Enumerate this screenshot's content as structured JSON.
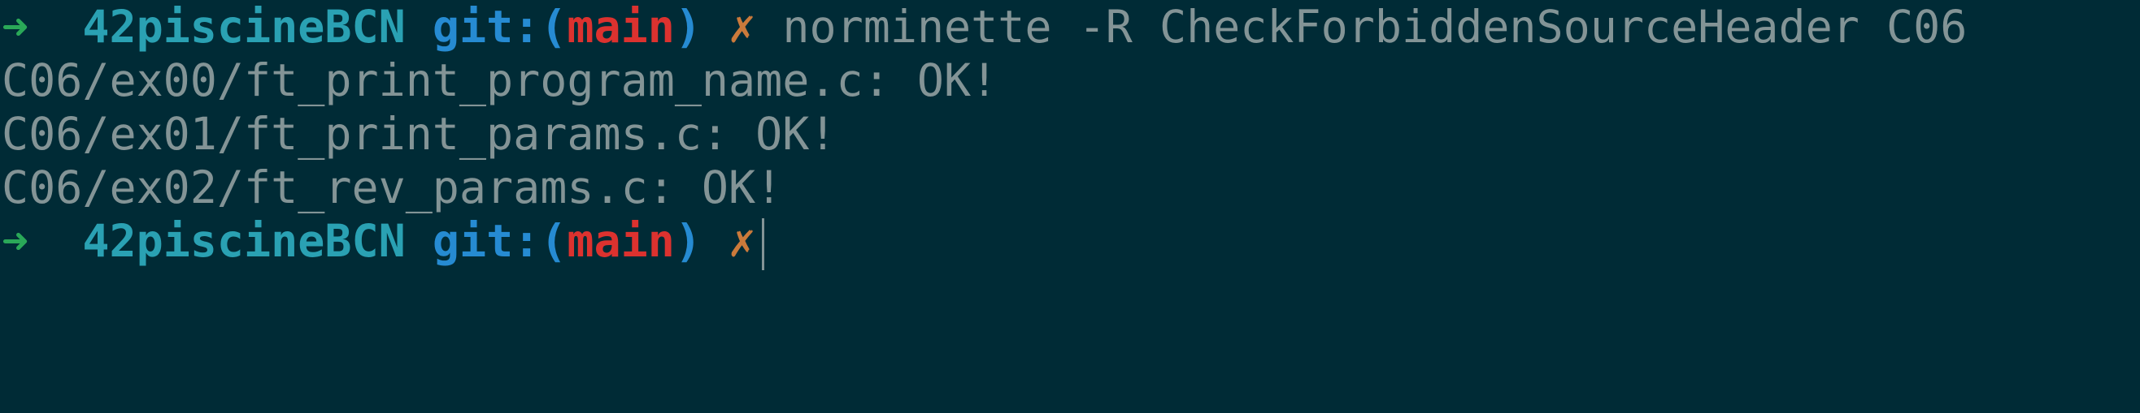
{
  "prompt": {
    "arrow": "➜",
    "directory": "42piscineBCN",
    "git_label": "git:",
    "open_paren": "(",
    "branch": "main",
    "close_paren": ")",
    "dirty_mark": "✗"
  },
  "command": "norminette -R CheckForbiddenSourceHeader C06",
  "output_lines": [
    "C06/ex00/ft_print_program_name.c: OK!",
    "C06/ex01/ft_print_params.c: OK!",
    "C06/ex02/ft_rev_params.c: OK!"
  ],
  "colors": {
    "background": "#002b36",
    "text": "#839496",
    "arrow": "#2aa858",
    "directory": "#2aa1b3",
    "git": "#268bd2",
    "branch": "#dc322f",
    "dirty": "#cb7a3b"
  }
}
